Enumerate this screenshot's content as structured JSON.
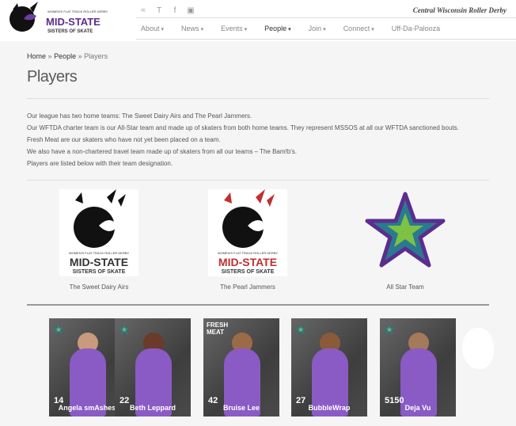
{
  "header": {
    "logo_alt": "Mid-State Sisters of Skate",
    "tagline": "Central Wisconsin Roller Derby",
    "social": [
      "rss-icon",
      "twitter-icon",
      "facebook-icon",
      "instagram-icon"
    ]
  },
  "nav": {
    "items": [
      {
        "label": "About",
        "caret": true
      },
      {
        "label": "News",
        "caret": true
      },
      {
        "label": "Events",
        "caret": true
      },
      {
        "label": "People",
        "caret": true,
        "active": true
      },
      {
        "label": "Join",
        "caret": true
      },
      {
        "label": "Connect",
        "caret": true
      },
      {
        "label": "Uff-Da-Palooza",
        "caret": false
      }
    ]
  },
  "breadcrumb": {
    "home": "Home",
    "sep": "»",
    "people": "People",
    "current": "Players"
  },
  "page": {
    "title": "Players",
    "intro": [
      "Our league has two home teams: The Sweet Dairy Airs and The Pearl Jammers.",
      "Our WFTDA charter team is our All-Star team and made up of skaters from both home teams.  They represent MSSOS at all our WFTDA sanctioned bouts.",
      "Fresh Meat are our skaters who have not yet been placed on a team.",
      "We also have a non-chartered travel team made up of skaters from all our teams –  The Bam!b's.",
      "Players are listed below with their team designation."
    ]
  },
  "teams": [
    {
      "label": "The Sweet Dairy Airs",
      "logo_text": [
        "WOMEN'S FLAT TRACK ROLLER DERBY",
        "MID-STATE",
        "SISTERS OF SKATE"
      ]
    },
    {
      "label": "The Pearl Jammers",
      "logo_text": [
        "WOMEN'S FLAT TRACK ROLLER DERBY",
        "MID-STATE",
        "SISTERS OF SKATE"
      ]
    },
    {
      "label": "All Star Team"
    }
  ],
  "players": [
    {
      "number": "14",
      "name": "Angela smAshes",
      "badge": "star"
    },
    {
      "number": "22",
      "name": "Beth Leppard",
      "badge": "star"
    },
    {
      "number": "42",
      "name": "Bruise Lee",
      "badge": "fresh",
      "stamp": "FRESH MEAT"
    },
    {
      "number": "27",
      "name": "BubbleWrap",
      "badge": "star"
    },
    {
      "number": "5150",
      "name": "Deja Vu",
      "badge": "star"
    }
  ],
  "colors": {
    "accent": "#6b3fa0",
    "star_fill": "#7dc243",
    "star_teal": "#2a7a8f",
    "star_border": "#5b2d8e"
  }
}
